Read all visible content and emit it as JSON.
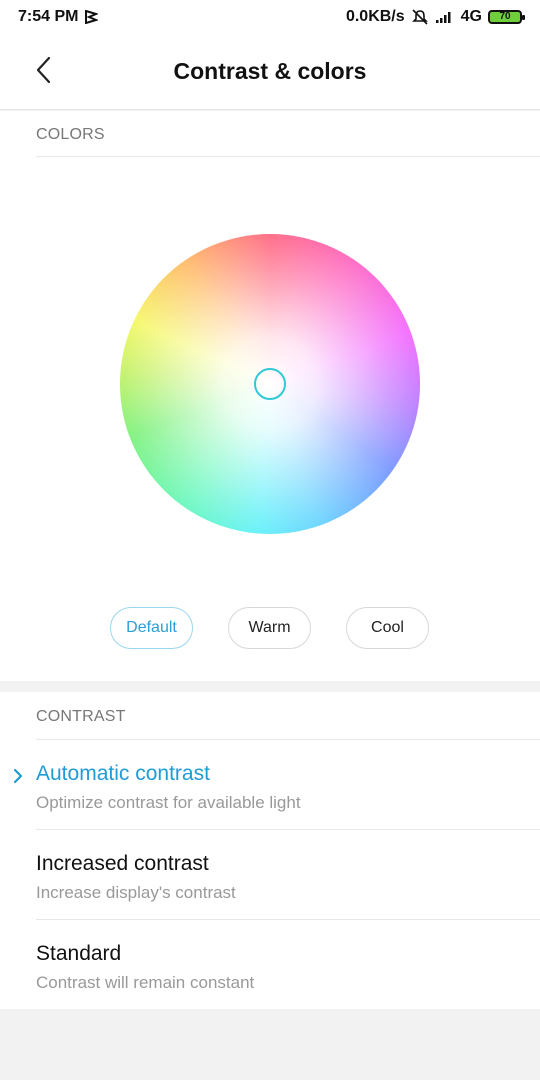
{
  "status_bar": {
    "time": "7:54 PM",
    "network_speed": "0.0KB/s",
    "network_type": "4G",
    "battery_level": "70",
    "icons": [
      "notification-flag-icon",
      "mute-icon",
      "signal-icon",
      "battery-icon"
    ]
  },
  "header": {
    "title": "Contrast & colors",
    "back_icon": "chevron-left-icon"
  },
  "colors": {
    "section_label": "COLORS",
    "tones": [
      {
        "label": "Default",
        "selected": true
      },
      {
        "label": "Warm",
        "selected": false
      },
      {
        "label": "Cool",
        "selected": false
      }
    ],
    "accent_color": "#2a9fd6",
    "cursor_color": "#31c8d8"
  },
  "contrast": {
    "section_label": "CONTRAST",
    "options": [
      {
        "title": "Automatic contrast",
        "subtitle": "Optimize contrast for available light",
        "selected": true
      },
      {
        "title": "Increased contrast",
        "subtitle": "Increase display's contrast",
        "selected": false
      },
      {
        "title": "Standard",
        "subtitle": "Contrast will remain constant",
        "selected": false
      }
    ],
    "selected_color": "#1f9bd6"
  }
}
